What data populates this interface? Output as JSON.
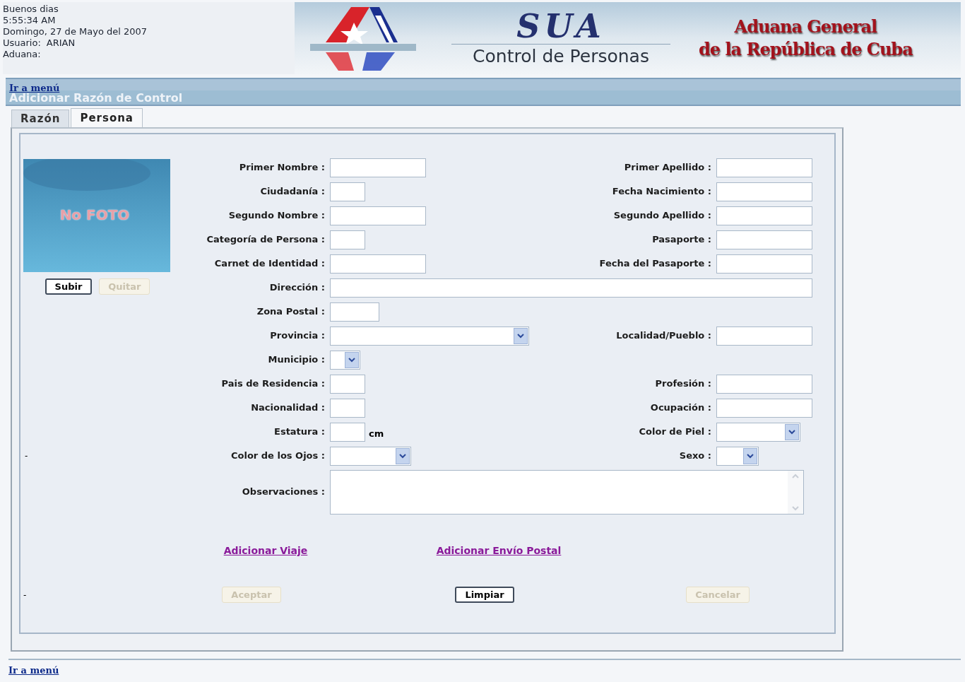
{
  "header": {
    "greeting": "Buenos dias",
    "time": "5:55:34 AM",
    "date": "Domingo, 27 de Mayo del 2007",
    "user_label": "Usuario:",
    "user": "ARIAN",
    "customs_label": "Aduana:",
    "app_name": "SUA",
    "app_subtitle": "Control de Personas",
    "org_line1": "Aduana General",
    "org_line2": "de la República de Cuba"
  },
  "menu_link_top": "Ir a menú",
  "page_title": "Adicionar Razón de Control",
  "tabs": [
    {
      "label": "Razón",
      "selected": false
    },
    {
      "label": "Persona",
      "selected": true
    }
  ],
  "photo": {
    "placeholder_text": "No FOTO",
    "buttons": [
      {
        "label": "Subir",
        "disabled": false
      },
      {
        "label": "Quitar",
        "disabled": true
      }
    ]
  },
  "side_marks": [
    "-",
    "-"
  ],
  "rows": [
    {
      "left": {
        "label": "Primer Nombre :",
        "kind": "text"
      },
      "right": {
        "label": "Primer Apellido :",
        "kind": "text"
      }
    },
    {
      "left": {
        "label": "Ciudadanía :",
        "kind": "text"
      },
      "right": {
        "label": "Fecha Nacimiento :",
        "kind": "text"
      }
    },
    {
      "left": {
        "label": "Segundo Nombre :",
        "kind": "text"
      },
      "right": {
        "label": "Segundo Apellido :",
        "kind": "text"
      }
    },
    {
      "left": {
        "label": "Categoría de Persona :",
        "kind": "text"
      },
      "right": {
        "label": "Pasaporte :",
        "kind": "text"
      }
    },
    {
      "left": {
        "label": "Carnet de Identidad :",
        "kind": "text"
      },
      "right": {
        "label": "Fecha del Pasaporte :",
        "kind": "text"
      }
    },
    {
      "left": {
        "label": "Dirección :",
        "kind": "text"
      }
    },
    {
      "left": {
        "label": "Zona Postal :",
        "kind": "text"
      }
    },
    {
      "left": {
        "label": "Provincia :",
        "kind": "select"
      },
      "right": {
        "label": "Localidad/Pueblo :",
        "kind": "text"
      }
    },
    {
      "left": {
        "label": "Municipio :",
        "kind": "select"
      }
    },
    {
      "left": {
        "label": "Pais de Residencia :",
        "kind": "text"
      },
      "right": {
        "label": "Profesión :",
        "kind": "text"
      }
    },
    {
      "left": {
        "label": "Nacionalidad :",
        "kind": "text"
      },
      "right": {
        "label": "Ocupación :",
        "kind": "text"
      }
    },
    {
      "left": {
        "label": "Estatura :",
        "kind": "text",
        "unit": "cm"
      },
      "right": {
        "label": "Color de Piel :",
        "kind": "select"
      }
    },
    {
      "left": {
        "label": "Color de los Ojos :",
        "kind": "select"
      },
      "right": {
        "label": "Sexo :",
        "kind": "select"
      }
    },
    {
      "left": {
        "label": "Observaciones :",
        "kind": "textarea"
      }
    }
  ],
  "links": [
    "Adicionar Viaje",
    "Adicionar Envío Postal"
  ],
  "actions": [
    {
      "label": "Aceptar",
      "disabled": true
    },
    {
      "label": "Limpiar",
      "disabled": false
    },
    {
      "label": "Cancelar",
      "disabled": true
    }
  ],
  "menu_link_bottom": "Ir a menú"
}
